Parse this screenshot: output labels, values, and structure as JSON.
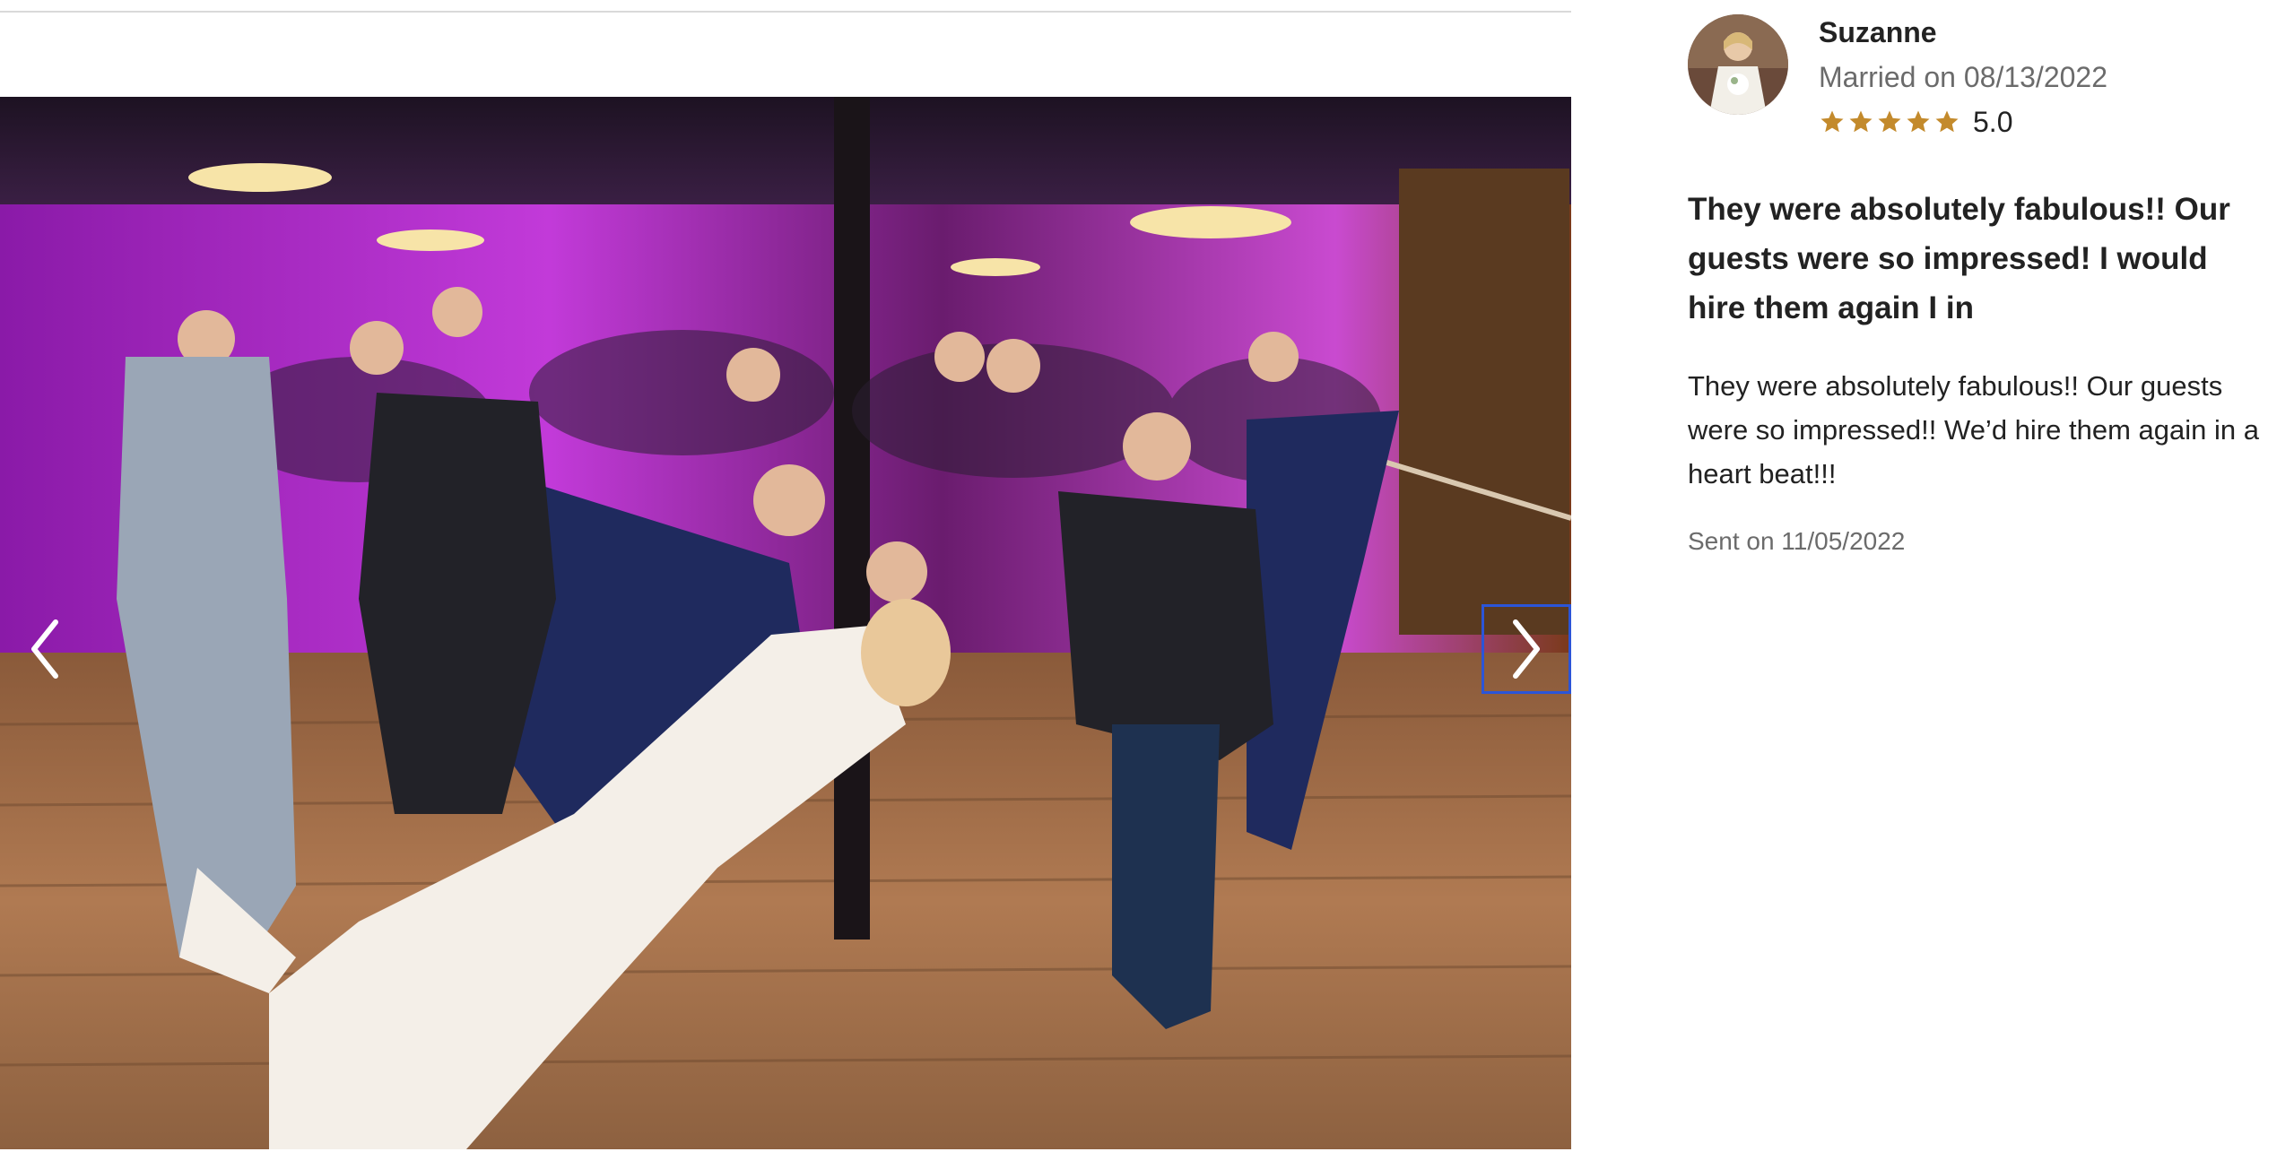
{
  "gallery": {
    "photo_alt": "",
    "prev_icon": "chevron-left-icon",
    "next_icon": "chevron-right-icon",
    "focus_color": "#2b55d8"
  },
  "review": {
    "reviewer_name": "Suzanne",
    "married_on": "Married on 08/13/2022",
    "rating": 5,
    "rating_text": "5.0",
    "star_color": "#c38a2c",
    "title": "They were absolutely fabulous!! Our guests were so impressed! I would hire them again I in",
    "body": "They were absolutely fabulous!! Our guests were so impressed!! We’d hire them again in a heart beat!!!",
    "sent_on": "Sent on 11/05/2022"
  }
}
